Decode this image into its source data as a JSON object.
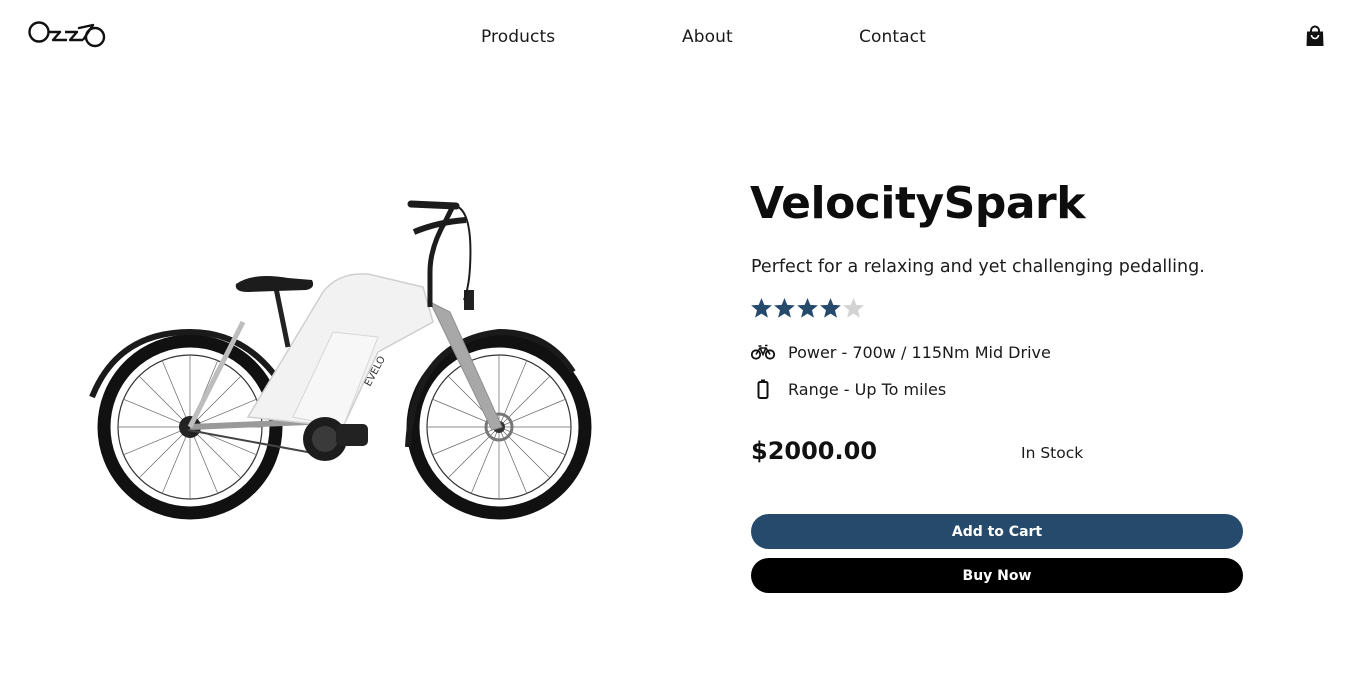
{
  "header": {
    "logo_alt": "OSSO",
    "nav": [
      {
        "label": "Products"
      },
      {
        "label": "About"
      },
      {
        "label": "Contact"
      }
    ],
    "cart_icon": "shopping-bag-icon"
  },
  "product": {
    "name": "VelocitySpark",
    "tagline": "Perfect for a relaxing and yet challenging pedalling.",
    "rating": 4,
    "rating_max": 5,
    "specs": [
      {
        "icon": "bicycle-icon",
        "text": "Power - 700w / 115Nm Mid Drive"
      },
      {
        "icon": "battery-icon",
        "text": "Range - Up To miles"
      }
    ],
    "price": "$2000.00",
    "stock_status": "In Stock",
    "frame_text": "EVELO"
  },
  "actions": {
    "add_to_cart": "Add to Cart",
    "buy_now": "Buy Now"
  },
  "colors": {
    "accent": "#254a6c",
    "primary_button": "#000000",
    "star_filled": "#254a6c",
    "star_empty": "#d3d3d3",
    "frame": "#f2f2f2",
    "fork": "#a8a8a8"
  }
}
